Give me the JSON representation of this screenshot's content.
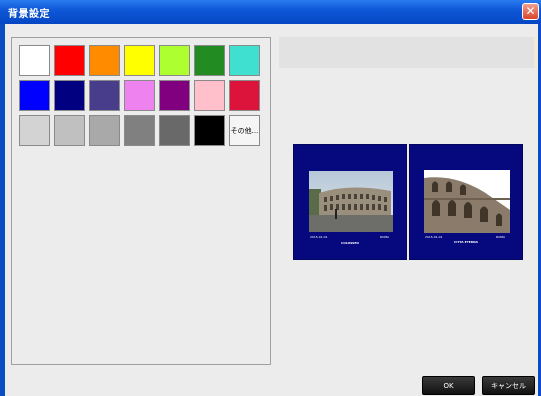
{
  "window": {
    "title": "背景設定",
    "close_glyph": "✕"
  },
  "palette": {
    "rows": [
      [
        "#ffffff",
        "#ff0000",
        "#ff8c00",
        "#ffff00",
        "#adff2f",
        "#228b22",
        "#40e0d0"
      ],
      [
        "#0000ff",
        "#000080",
        "#483d8b",
        "#ee82ee",
        "#800080",
        "#ffc0cb",
        "#dc143c"
      ],
      [
        "#d3d3d3",
        "#c0c0c0",
        "#a9a9a9",
        "#808080",
        "#696969",
        "#000000"
      ]
    ],
    "other_label": "その他..."
  },
  "preview": {
    "background_color": "#06087d",
    "pages": [
      {
        "caption": "COLOSSEO",
        "left_text": "2015-01-01",
        "right_text": "ROMA"
      },
      {
        "caption": "CITTA ETERNA",
        "left_text": "2015-01-01",
        "right_text": "ROMA"
      }
    ]
  },
  "buttons": {
    "ok": "OK",
    "cancel": "キャンセル"
  }
}
